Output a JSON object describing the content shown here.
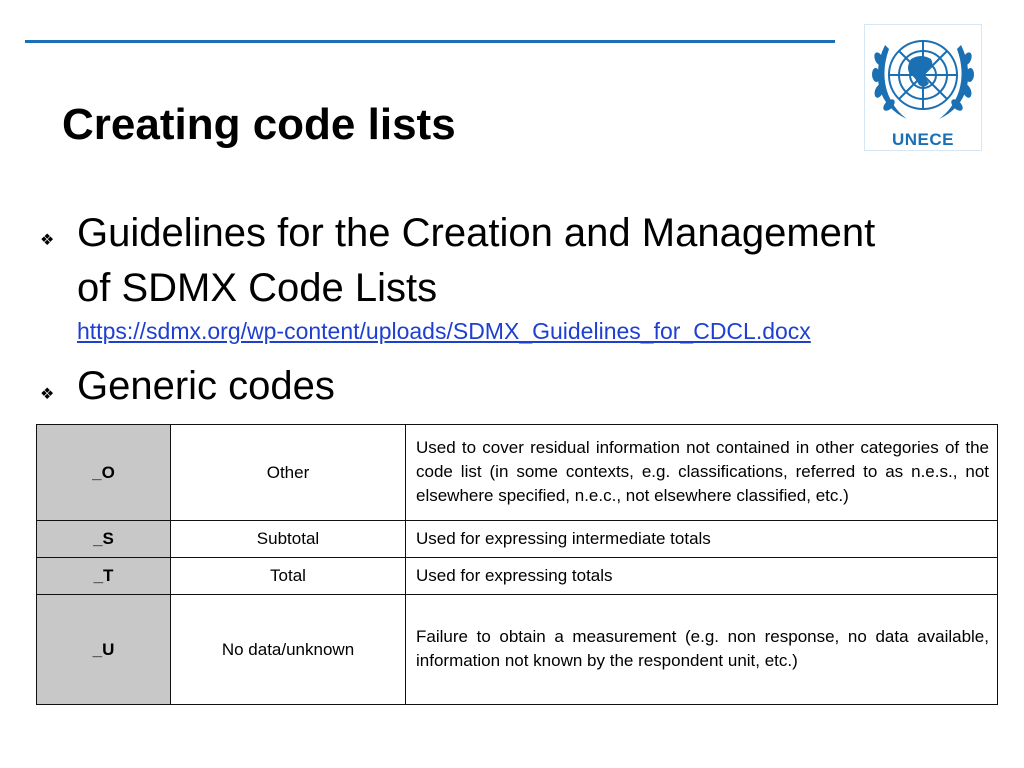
{
  "slide": {
    "title": "Creating code lists",
    "logo": {
      "text": "UNECE",
      "emblem_icon": "un-emblem-icon",
      "color": "#1b6fb3"
    },
    "accent_color": "#1f6fb7",
    "bullet_icon": "four-diamond-bullet-icon",
    "bullets": [
      {
        "line1": "Guidelines for the Creation and Management",
        "line2": "of SDMX Code Lists",
        "link": "https://sdmx.org/wp-content/uploads/SDMX_Guidelines_for_CDCL.docx"
      },
      {
        "line1": "Generic codes"
      }
    ],
    "table": {
      "rows": [
        {
          "code": "_O",
          "label": "Other",
          "description": "Used to cover residual information not contained in other categories of the code list (in some contexts, e.g. classifications, referred to as n.e.s., not elsewhere specified, n.e.c., not elsewhere classified, etc.)"
        },
        {
          "code": "_S",
          "label": "Subtotal",
          "description": "Used for expressing intermediate totals"
        },
        {
          "code": "_T",
          "label": "Total",
          "description": "Used for expressing totals"
        },
        {
          "code": "_U",
          "label": "No data/unknown",
          "description": "Failure to obtain a measurement (e.g. non response, no data available, information not known by the respondent unit, etc.)"
        }
      ]
    }
  }
}
